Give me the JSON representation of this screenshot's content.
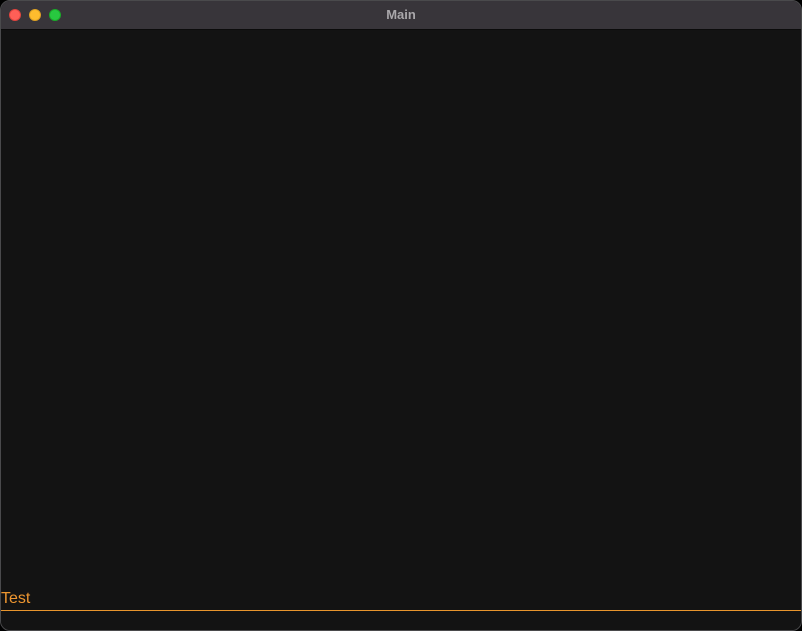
{
  "window": {
    "title": "Main"
  },
  "input": {
    "value": "Test"
  },
  "colors": {
    "accent": "#ee9630",
    "background": "#131313",
    "titlebar": "#38353a"
  }
}
